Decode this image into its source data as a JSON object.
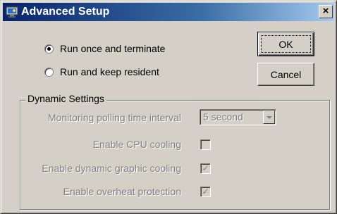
{
  "window": {
    "title": "Advanced Setup",
    "icon": "monitor-app-icon",
    "close_label": "×"
  },
  "mode": {
    "options": [
      {
        "label": "Run once and terminate",
        "checked": true
      },
      {
        "label": "Run and keep resident",
        "checked": false
      }
    ]
  },
  "buttons": {
    "ok_label": "OK",
    "cancel_label": "Cancel"
  },
  "dynamic": {
    "legend": "Dynamic Settings",
    "polling_label": "Monitoring polling time interval",
    "polling_value": "5 second",
    "cpu_label": "Enable CPU cooling",
    "cpu_checked": false,
    "graphic_label": "Enable dynamic graphic cooling",
    "graphic_checked": true,
    "overheat_label": "Enable overheat protection",
    "overheat_checked": true,
    "check_glyph": "✓"
  },
  "colors": {
    "titlebar_start": "#0a246a",
    "titlebar_end": "#a6caf0",
    "face": "#d4d0c8",
    "disabled_text": "#808080"
  }
}
